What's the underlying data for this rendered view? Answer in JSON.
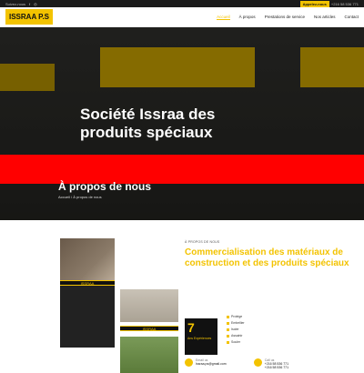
{
  "topbar": {
    "left_text": "Suivez-nous",
    "social_icons": [
      "facebook-icon",
      "instagram-icon"
    ],
    "phone_label": "Appelez-nous",
    "phone_number": "+216 58 536 771"
  },
  "header": {
    "logo": "ISSRAA P.S",
    "nav": [
      "Accueil",
      "À propos",
      "Prestations de service",
      "Nos articles",
      "Contact"
    ]
  },
  "hero": {
    "title": "Société Issraa des produits spéciaux",
    "banner_title": "À propos de nous",
    "breadcrumbs": "Accueil / À propos de nous"
  },
  "about": {
    "kicker": "À PROPOS DE NOUS",
    "title": "Commercialisation des matériaux de construction et des produits spéciaux",
    "experience_years": "7",
    "experience_label": "Ans Expériences",
    "features": [
      "Protège",
      "Embellier",
      "Isoler",
      "Assainir",
      "Souler"
    ],
    "contacts": [
      {
        "label": "Email us",
        "value": "Issraa.ps@gmail.com"
      },
      {
        "label": "Call us",
        "value": "+216 58 536 771\n+216 58 536 771"
      }
    ],
    "brand_strip": "ISSRAA"
  },
  "colors": {
    "accent": "#f3c300",
    "dark": "#111111",
    "band": "#ff0000"
  }
}
